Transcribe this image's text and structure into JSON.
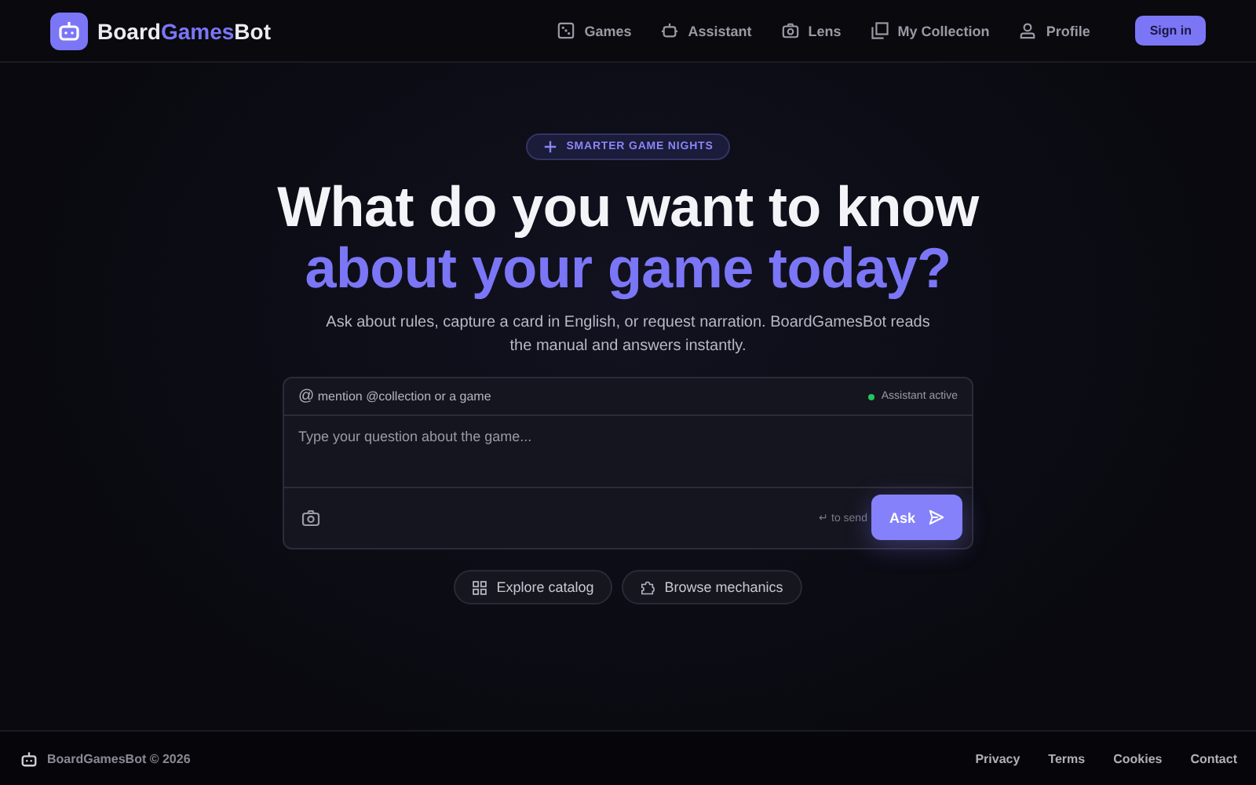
{
  "header": {
    "brand": [
      {
        "text": "Board",
        "accent": false
      },
      {
        "text": "Games",
        "accent": true
      },
      {
        "text": "Bot",
        "accent": false
      }
    ],
    "nav": [
      {
        "label": "Games",
        "kind": "dice"
      },
      {
        "label": "Assistant",
        "kind": "robot"
      },
      {
        "label": "Lens",
        "kind": "camera"
      },
      {
        "label": "My Collection",
        "kind": "stack"
      },
      {
        "label": "Profile",
        "kind": "person"
      }
    ],
    "sign_in": "Sign in"
  },
  "hero": {
    "badge": "SMARTER GAME NIGHTS",
    "title_line_1": "What do you want to know",
    "title_line_2": "about your game today?",
    "subtitle": "Ask about rules, capture a card in English, or request narration. BoardGamesBot reads the manual and answers instantly."
  },
  "composer": {
    "mention_icon": "@",
    "mention": "mention @collection or a game",
    "status": {
      "label": "Assistant active",
      "active": true
    },
    "placeholder": "Type your question about the game...",
    "hint": "↵ to send",
    "ask": "Ask"
  },
  "chips": [
    {
      "label": "Explore catalog",
      "kind": "grid"
    },
    {
      "label": "Browse mechanics",
      "kind": "puzzle"
    }
  ],
  "footer": {
    "copyright": "BoardGamesBot © 2026",
    "links": [
      "Privacy",
      "Terms",
      "Cookies",
      "Contact"
    ]
  }
}
